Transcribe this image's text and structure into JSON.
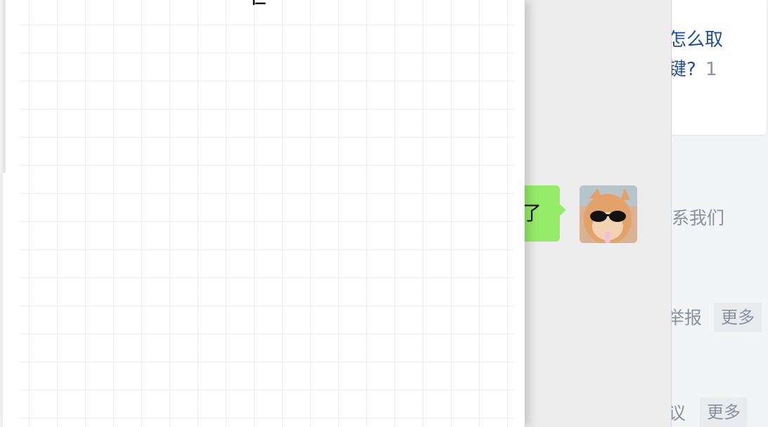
{
  "background_page": {
    "question_link_line1": "怎么取",
    "question_link_line2": "键?",
    "answer_count": "1",
    "contact_text": "系我们",
    "report_text": "举报",
    "more_label_1": "更多",
    "suggest_text": "议",
    "more_label_2": "更多"
  },
  "chat": {
    "message_text": "了",
    "avatar_icon": "cat-with-sunglasses-avatar"
  },
  "board": {
    "glyph": "仨"
  },
  "colors": {
    "link": "#1f4e9c",
    "chat_bubble": "#95ec69",
    "muted_text": "#8a919f"
  }
}
